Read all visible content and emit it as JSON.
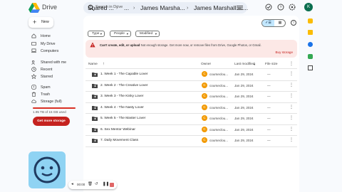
{
  "app": {
    "brand": "Drive"
  },
  "search": {
    "placeholder": "Search in Drive"
  },
  "user": {
    "avatar_letter": "K"
  },
  "sidebar": {
    "new_label": "New",
    "items": [
      {
        "label": "Home",
        "icon": "home-icon"
      },
      {
        "label": "My Drive",
        "icon": "my-drive-icon"
      },
      {
        "label": "Computers",
        "icon": "computer-icon"
      },
      {
        "label": "Shared with me",
        "icon": "shared-icon"
      },
      {
        "label": "Recent",
        "icon": "clock-icon"
      },
      {
        "label": "Starred",
        "icon": "star-icon"
      },
      {
        "label": "Spam",
        "icon": "spam-icon"
      },
      {
        "label": "Trash",
        "icon": "trash-icon"
      },
      {
        "label": "Storage (full)",
        "icon": "cloud-icon"
      }
    ],
    "storage_text": "1.95 TB of 15 GB used",
    "storage_fraction": 1.0,
    "get_more_label": "Get more storage"
  },
  "breadcrumb": {
    "items": [
      "Shared ...",
      "...",
      "James Marsha...",
      "James Marshall – ..."
    ]
  },
  "filters": [
    "Type",
    "People",
    "Modified"
  ],
  "banner": {
    "bold": "Can't create, edit, or upload",
    "text": " Not enough storage. Get more now, or remove files from Drive, Google Photos, or Gmail.",
    "action": "Buy storage"
  },
  "table": {
    "headers": {
      "name": "Name",
      "owner": "Owner",
      "modified": "Last modified",
      "size": "File size"
    },
    "rows": [
      {
        "name": "1. Week 1 - The Capable Lover",
        "owner": "courseclou...",
        "modified": "Jan 29, 2024",
        "size": "—"
      },
      {
        "name": "2. Week 2 - The Creative Lover",
        "owner": "courseclou...",
        "modified": "Jan 29, 2024",
        "size": "—"
      },
      {
        "name": "3. Week 3 - The Kinky Lover",
        "owner": "courseclou...",
        "modified": "Jan 29, 2024",
        "size": "—"
      },
      {
        "name": "4. Week 4 - The Nasty Lover",
        "owner": "courseclou...",
        "modified": "Jan 29, 2024",
        "size": "—"
      },
      {
        "name": "5. Week 5 - The Master Lover",
        "owner": "courseclou...",
        "modified": "Jan 29, 2024",
        "size": "—"
      },
      {
        "name": "6. Sex Mentor Webinar",
        "owner": "courseclou...",
        "modified": "Jan 29, 2024",
        "size": "—"
      },
      {
        "name": "7. Daily Movement Class",
        "owner": "courseclou...",
        "modified": "Jan 29, 2024",
        "size": "—"
      }
    ]
  },
  "recorder": {
    "time": "00:00"
  },
  "colors": {
    "accent": "#0b57d0",
    "danger": "#c5221f",
    "banner_bg": "#fce8e6",
    "owner_avatar": "#f29900"
  }
}
